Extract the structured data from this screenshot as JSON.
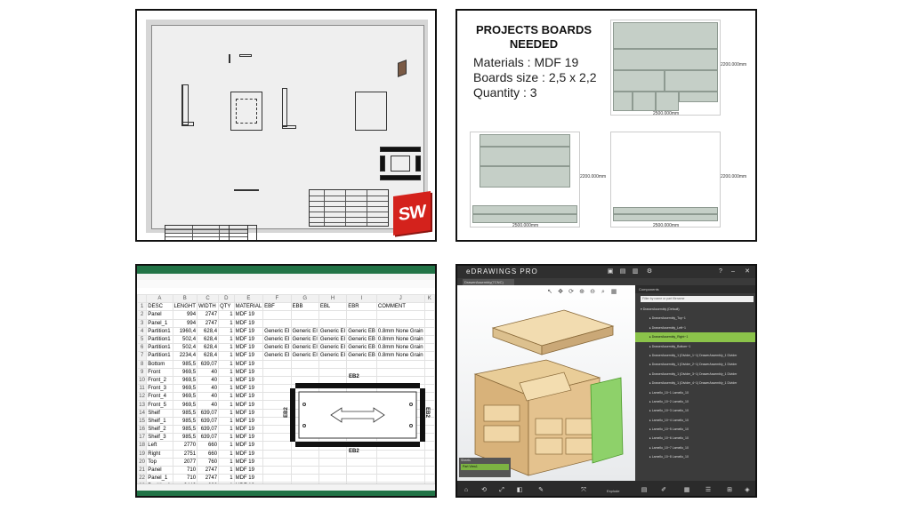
{
  "cad": {
    "logo_text": "SW",
    "brand_color": "#d4221c"
  },
  "boards": {
    "title": "PROJECTS BOARDS NEEDED",
    "materials": "Materials : MDF 19",
    "size": "Boards size : 2,5 x 2,2",
    "quantity": "Quantity : 3",
    "dim_width": "2500.000mm",
    "dim_height": "2200.000mm",
    "piece_color": "#c5cfc7"
  },
  "sheet": {
    "columns": [
      "",
      "A",
      "B",
      "C",
      "D",
      "E",
      "F",
      "G",
      "H",
      "I",
      "J",
      "K"
    ],
    "header": [
      "DESC",
      "LENGHT",
      "WIDTH",
      "QTY",
      "MATERIAL",
      "EBF",
      "EBB",
      "EBL",
      "EBR",
      "COMMENT",
      ""
    ],
    "rows": [
      [
        "Panel",
        "994",
        "2747",
        "1",
        "MDF 19",
        "",
        "",
        "",
        "",
        "",
        ""
      ],
      [
        "Panel_1",
        "994",
        "2747",
        "1",
        "MDF 19",
        "",
        "",
        "",
        "",
        "",
        ""
      ],
      [
        "Partition1",
        "1960,4",
        "628,4",
        "1",
        "MDF 19",
        "Generic EI",
        "Generic EI",
        "Generic EI",
        "Generic EB",
        "0.8mm None Grain",
        ""
      ],
      [
        "Partition1",
        "502,4",
        "628,4",
        "1",
        "MDF 19",
        "Generic EI",
        "Generic EI",
        "Generic EI",
        "Generic EB",
        "0.8mm None Grain",
        ""
      ],
      [
        "Partition1",
        "502,4",
        "628,4",
        "1",
        "MDF 19",
        "Generic EI",
        "Generic EI",
        "Generic EI",
        "Generic EB",
        "0.8mm None Grain",
        ""
      ],
      [
        "Partition1",
        "2234,4",
        "628,4",
        "1",
        "MDF 19",
        "Generic EI",
        "Generic EI",
        "Generic EI",
        "Generic EB",
        "0.8mm None Grain",
        ""
      ],
      [
        "Bottom",
        "985,5",
        "639,07",
        "1",
        "MDF 19",
        "",
        "",
        "",
        "",
        "",
        ""
      ],
      [
        "Front",
        "969,5",
        "40",
        "1",
        "MDF 19",
        "",
        "",
        "",
        "",
        "",
        ""
      ],
      [
        "Front_2",
        "969,5",
        "40",
        "1",
        "MDF 19",
        "",
        "",
        "",
        "",
        "",
        ""
      ],
      [
        "Front_3",
        "969,5",
        "40",
        "1",
        "MDF 19",
        "",
        "",
        "",
        "",
        "",
        ""
      ],
      [
        "Front_4",
        "969,5",
        "40",
        "1",
        "MDF 19",
        "",
        "",
        "",
        "",
        "",
        ""
      ],
      [
        "Front_5",
        "969,5",
        "40",
        "1",
        "MDF 19",
        "",
        "",
        "",
        "",
        "",
        ""
      ],
      [
        "Shelf",
        "985,5",
        "639,07",
        "1",
        "MDF 19",
        "",
        "",
        "",
        "",
        "",
        ""
      ],
      [
        "Shelf_1",
        "985,5",
        "639,07",
        "1",
        "MDF 19",
        "",
        "",
        "",
        "",
        "",
        ""
      ],
      [
        "Shelf_2",
        "985,5",
        "639,07",
        "1",
        "MDF 19",
        "",
        "",
        "",
        "",
        "",
        ""
      ],
      [
        "Shelf_3",
        "985,5",
        "639,07",
        "1",
        "MDF 19",
        "",
        "",
        "",
        "",
        "",
        ""
      ],
      [
        "Left",
        "2770",
        "660",
        "1",
        "MDF 19",
        "",
        "",
        "",
        "",
        "",
        ""
      ],
      [
        "Right",
        "2751",
        "660",
        "1",
        "MDF 19",
        "",
        "",
        "",
        "",
        "",
        ""
      ],
      [
        "Top",
        "2077",
        "760",
        "1",
        "MDF 19",
        "",
        "",
        "",
        "",
        "",
        ""
      ],
      [
        "Panel",
        "710",
        "2747",
        "1",
        "MDF 19",
        "",
        "",
        "",
        "",
        "",
        ""
      ],
      [
        "Panel_1",
        "710",
        "2747",
        "1",
        "MDF 19",
        "",
        "",
        "",
        "",
        "",
        ""
      ],
      [
        "Partition1",
        "2440",
        "626",
        "1",
        "MDF 19",
        "",
        "",
        "",
        "",
        "",
        ""
      ]
    ],
    "eb_top": "EB2",
    "eb_bottom": "EB2",
    "eb_left": "EB2",
    "eb_right": "EB2",
    "accent": "#217346"
  },
  "edrawings": {
    "logo": "eDRAWINGS PRO",
    "tab_label": "DrawerAssembly(7CNC)",
    "side_header": "Components",
    "search_placeholder": "Filter by name or part filename",
    "tree": [
      "DrawerAssembly (Default)",
      "DrawerAssembly_Top~1",
      "DrawerAssembly_Left~1",
      "DrawerAssembly_Right~1",
      "DrawerAssembly_Bottom~1",
      "DrawerAssembly_1 (Divider_1~1) DrawerAssembly_1 Divider",
      "DrawerAssembly_1 (Divider_2~1) DrawerAssembly_1 Divider",
      "DrawerAssembly_1 (Divider_3~1) DrawerAssembly_1 Divider",
      "DrawerAssembly_1 (Divider_4~1) DrawerAssembly_1 Divider",
      "Lamello_10~1 Lamello_10",
      "Lamello_10~2 Lamello_10",
      "Lamello_10~3 Lamello_10",
      "Lamello_10~4 Lamello_10",
      "Lamello_10~5 Lamello_10",
      "Lamello_10~6 Lamello_10",
      "Lamello_10~7 Lamello_10",
      "Lamello_10~8 Lamello_10"
    ],
    "selected_index": 3,
    "sheets_header": "Sheets",
    "sheet_item": "Part View1",
    "bottom_label": "Explode",
    "select_color": "#8bc34a"
  }
}
